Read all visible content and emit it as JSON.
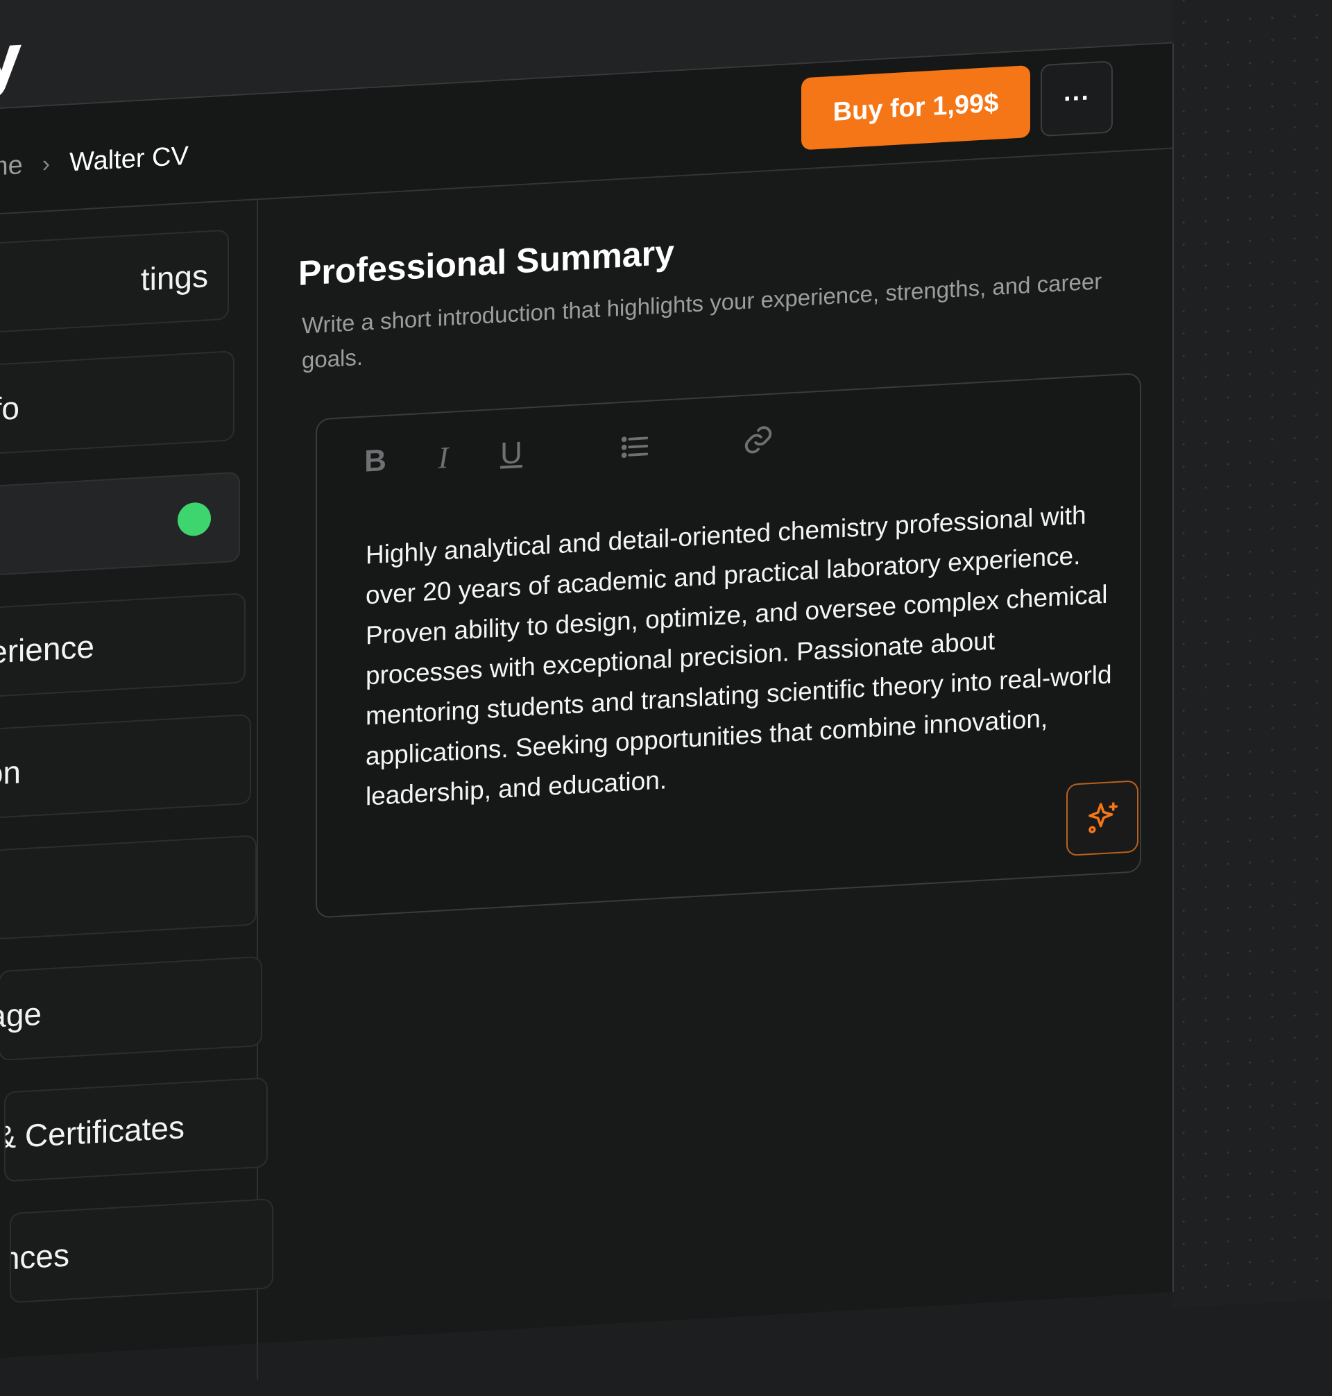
{
  "app": {
    "logo_fragment": "y"
  },
  "breadcrumb": {
    "home": "me",
    "separator": "›",
    "current": "Walter CV"
  },
  "header": {
    "buy_label": "Buy for 1,99$",
    "more_label": "···"
  },
  "sidebar": {
    "items": [
      {
        "label": "tings",
        "active": false
      },
      {
        "label": "nfo",
        "active": false
      },
      {
        "label": "",
        "active": true,
        "status": "complete"
      },
      {
        "label": "perience",
        "active": false
      },
      {
        "label": "on",
        "active": false
      },
      {
        "label": "",
        "active": false
      },
      {
        "label": "uage",
        "active": false
      },
      {
        "label": "rses & Certificates",
        "active": false
      },
      {
        "label": "erences",
        "active": false
      }
    ]
  },
  "section": {
    "title": "Professional Summary",
    "description": "Write a short introduction that highlights your experience, strengths, and career goals."
  },
  "editor": {
    "toolbar": [
      "B",
      "I",
      "U",
      "list-icon",
      "link-icon"
    ],
    "text": "Highly analytical and detail-oriented chemistry professional with over 20 years of academic and practical laboratory experience. Proven ability to design, optimize, and oversee complex chemical processes with exceptional precision. Passionate about mentoring students and translating scientific theory into real-world applications. Seeking opportunities that combine innovation, leadership, and education."
  },
  "colors": {
    "accent": "#f57616",
    "status_ok": "#3ed46e",
    "background": "#181919"
  }
}
